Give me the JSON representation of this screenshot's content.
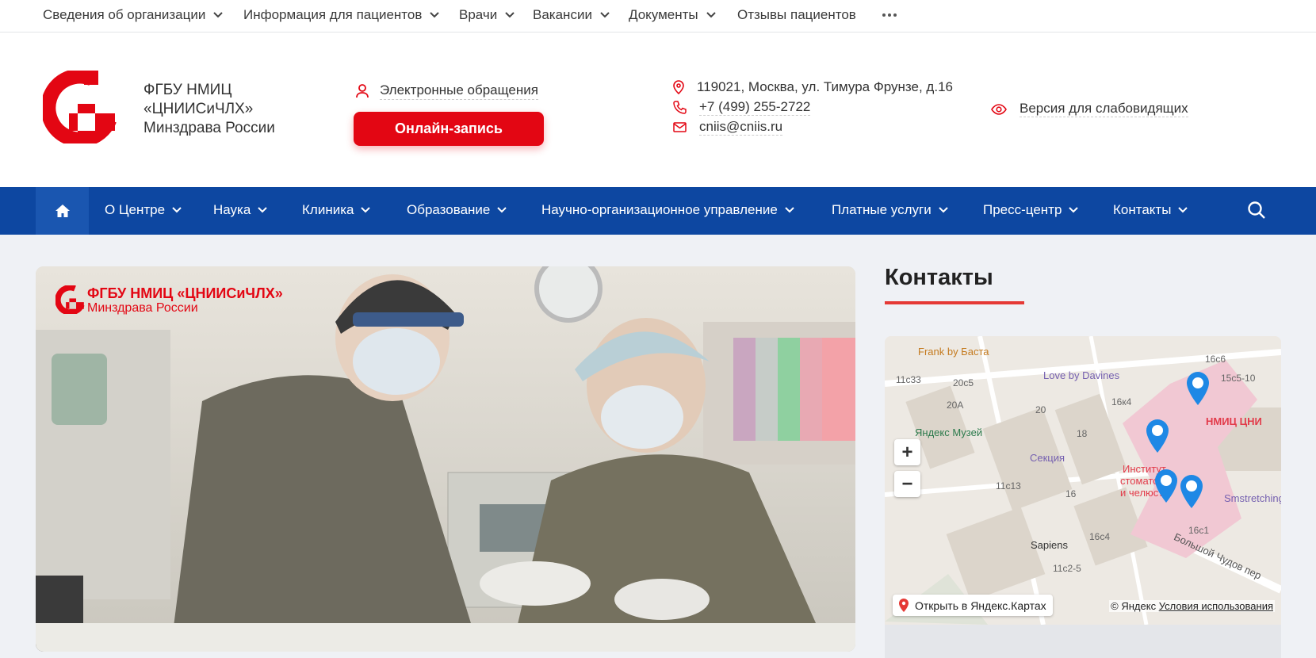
{
  "topbar": {
    "items": [
      {
        "label": "Сведения об организации"
      },
      {
        "label": "Информация для пациентов"
      },
      {
        "label": "Врачи"
      },
      {
        "label": "Вакансии"
      },
      {
        "label": "Документы"
      },
      {
        "label": "Отзывы пациентов"
      }
    ]
  },
  "header": {
    "org_line1": "ФГБУ НМИЦ",
    "org_line2": "«ЦНИИСиЧЛХ»",
    "org_line3": "Минздрава России",
    "appeal_label": "Электронные обращения",
    "online_button": "Онлайн-запись",
    "address": "119021, Москва, ул. Тимура Фрунзе, д.16",
    "phone": "+7 (499) 255-2722",
    "email": "cniis@cniis.ru",
    "low_vision": "Версия для слабовидящих"
  },
  "nav": {
    "items": [
      {
        "label": "О Центре"
      },
      {
        "label": "Наука"
      },
      {
        "label": "Клиника"
      },
      {
        "label": "Образование"
      },
      {
        "label": "Научно-организационное управление"
      },
      {
        "label": "Платные услуги"
      },
      {
        "label": "Пресс-центр"
      },
      {
        "label": "Контакты"
      }
    ]
  },
  "hero": {
    "brand_line1": "ФГБУ НМИЦ «ЦНИИСиЧЛХ»",
    "brand_line2": "Минздрава России"
  },
  "sidebar": {
    "title": "Контакты",
    "map": {
      "labels": [
        "Frank by Баста",
        "Love by Davines",
        "Яндекс Музей",
        "Секция",
        "НМИЦ ЦНИ",
        "Институт",
        "стомато",
        "и челюст",
        "Smstretching",
        "Sapiens",
        "Большой Чудов пер",
        "11с33",
        "20с5",
        "20А",
        "20",
        "18",
        "16к4",
        "16с6",
        "15с5-10",
        "11с13",
        "16",
        "16с4",
        "16с1",
        "11с2-5"
      ],
      "open_label": "Открыть в Яндекс.Картах",
      "copyright": "© Яндекс",
      "terms": "Условия использования",
      "zoom_in": "+",
      "zoom_out": "−"
    }
  },
  "colors": {
    "brand_red": "#e30613",
    "nav_blue": "#0d47a1",
    "page_bg": "#eff1f5",
    "accent_underline": "#e53935"
  },
  "icons": {
    "logo": "cniis-logo",
    "user": "user-icon",
    "location": "location-pin-icon",
    "phone": "phone-icon",
    "email": "envelope-icon",
    "eye": "eye-icon",
    "home": "home-icon",
    "search": "search-icon",
    "chevron": "chevron-down-icon",
    "more": "more-dots-icon"
  }
}
